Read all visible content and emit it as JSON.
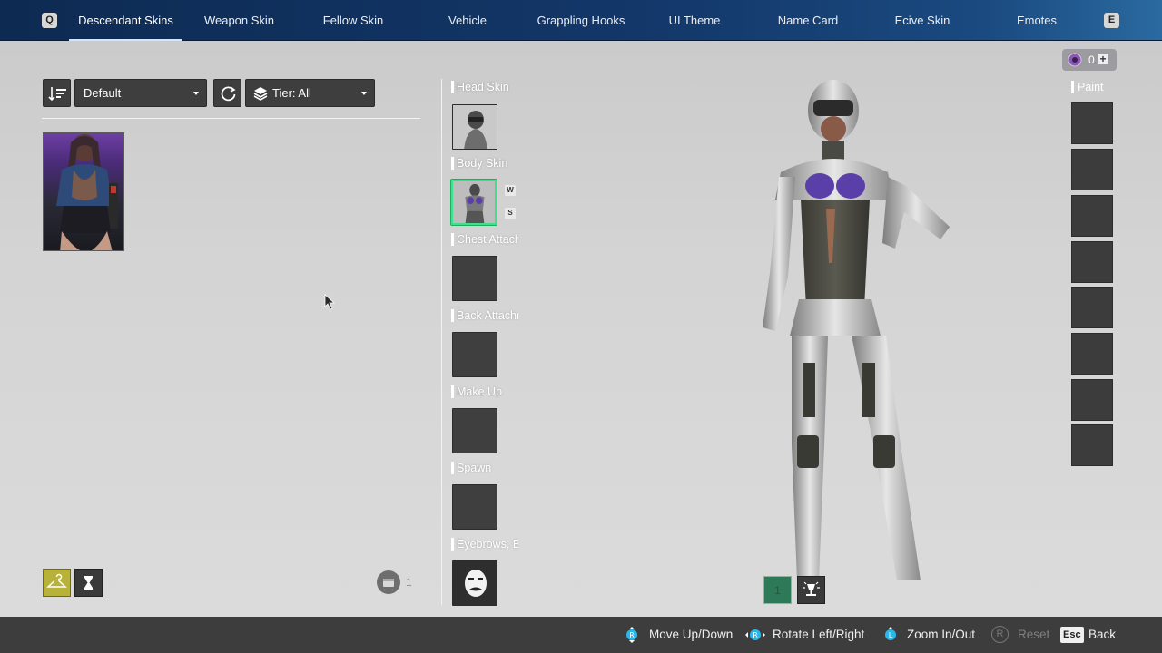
{
  "top_nav": {
    "prev_key": "Q",
    "next_key": "E",
    "tabs": [
      {
        "label": "Descendant Skins",
        "active": true
      },
      {
        "label": "Weapon Skin",
        "active": false
      },
      {
        "label": "Fellow Skin",
        "active": false
      },
      {
        "label": "Vehicle",
        "active": false
      },
      {
        "label": "Grappling Hooks",
        "active": false
      },
      {
        "label": "UI Theme",
        "active": false
      },
      {
        "label": "Name Card",
        "active": false
      },
      {
        "label": "Ecive Skin",
        "active": false
      },
      {
        "label": "Emotes",
        "active": false
      }
    ]
  },
  "filters": {
    "sort_value": "Default",
    "tier_value": "Tier: All"
  },
  "slots": [
    {
      "label": "Head Skin",
      "filled": true
    },
    {
      "label": "Body Skin",
      "filled": true,
      "selected": true,
      "tags": [
        "W",
        "S"
      ]
    },
    {
      "label": "Chest Attachment",
      "filled": false
    },
    {
      "label": "Back Attachment",
      "filled": false
    },
    {
      "label": "Make Up",
      "filled": false
    },
    {
      "label": "Spawn",
      "filled": false
    },
    {
      "label": "Eyebrows, Beard",
      "filled": true
    }
  ],
  "paint": {
    "label": "Paint",
    "slot_count": 8
  },
  "currency": {
    "amount": "0",
    "add_symbol": "+"
  },
  "left_footer": {
    "count": "1"
  },
  "preview_controls": {
    "slot_number": "1"
  },
  "bottom_hints": [
    {
      "label": "Move Up/Down",
      "key_icon": "right-stick-vertical-icon"
    },
    {
      "label": "Rotate Left/Right",
      "key_icon": "right-stick-horizontal-icon"
    },
    {
      "label": "Zoom In/Out",
      "key_icon": "stick-zoom-icon"
    },
    {
      "label": "Reset",
      "key": "R",
      "disabled": true
    },
    {
      "label": "Back",
      "key": "Esc"
    }
  ],
  "colors": {
    "nav_bg": "#133769",
    "selected_slot_border": "#3ee08a",
    "active_mode_button": "#b9b23a"
  }
}
